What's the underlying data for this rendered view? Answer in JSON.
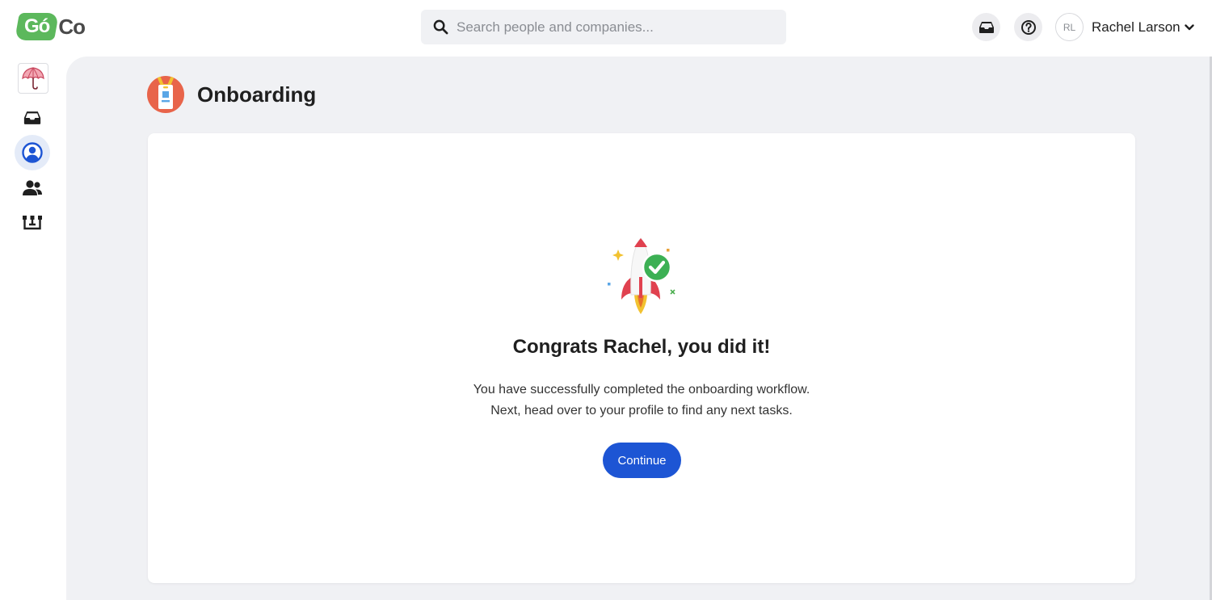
{
  "app": {
    "logo_badge_text": "Gó",
    "logo_rest_text": "Co",
    "brand_green": "#5cb85c",
    "accent_blue": "#1d55d4"
  },
  "header": {
    "search": {
      "placeholder": "Search people and companies..."
    },
    "icons": [
      "inbox-icon",
      "help-icon"
    ],
    "user": {
      "initials": "RL",
      "name": "Rachel Larson"
    }
  },
  "sidebar": {
    "items": [
      {
        "name": "company-logo",
        "icon": "umbrella-icon"
      },
      {
        "name": "inbox",
        "icon": "inbox-icon"
      },
      {
        "name": "my-profile",
        "icon": "user-circle-icon",
        "active": true
      },
      {
        "name": "people",
        "icon": "users-icon"
      },
      {
        "name": "org-chart",
        "icon": "org-chart-icon"
      }
    ]
  },
  "page": {
    "title": "Onboarding",
    "icon": "badge-icon"
  },
  "card": {
    "illustration": "rocket-check-icon",
    "heading": "Congrats Rachel, you did it!",
    "line1": "You have successfully completed the onboarding workflow.",
    "line2": "Next, head over to your profile to find any next tasks.",
    "button_label": "Continue"
  }
}
